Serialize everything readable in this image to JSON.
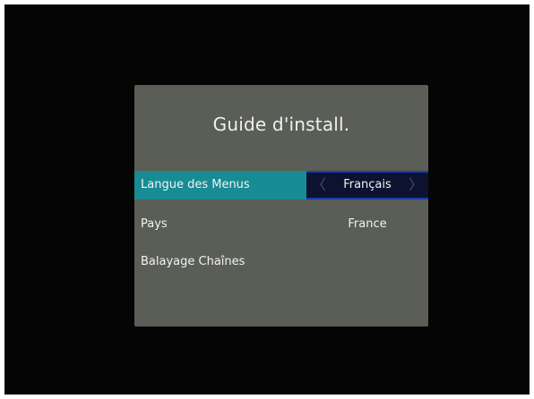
{
  "dialog": {
    "title": "Guide d'install.",
    "rows": [
      {
        "label": "Langue des Menus",
        "value": "Français",
        "selected": true
      },
      {
        "label": "Pays",
        "value": "France",
        "selected": false
      },
      {
        "label": "Balayage Chaînes",
        "value": "",
        "selected": false
      }
    ],
    "left_arrow_icon": "chevron-left-icon",
    "right_arrow_icon": "chevron-right-icon"
  },
  "colors": {
    "background": "#050505",
    "dialog": "#5a5e56",
    "selected_row": "#178c94",
    "selected_value": "#0c1230",
    "selected_value_border": "#1a3bb0"
  }
}
